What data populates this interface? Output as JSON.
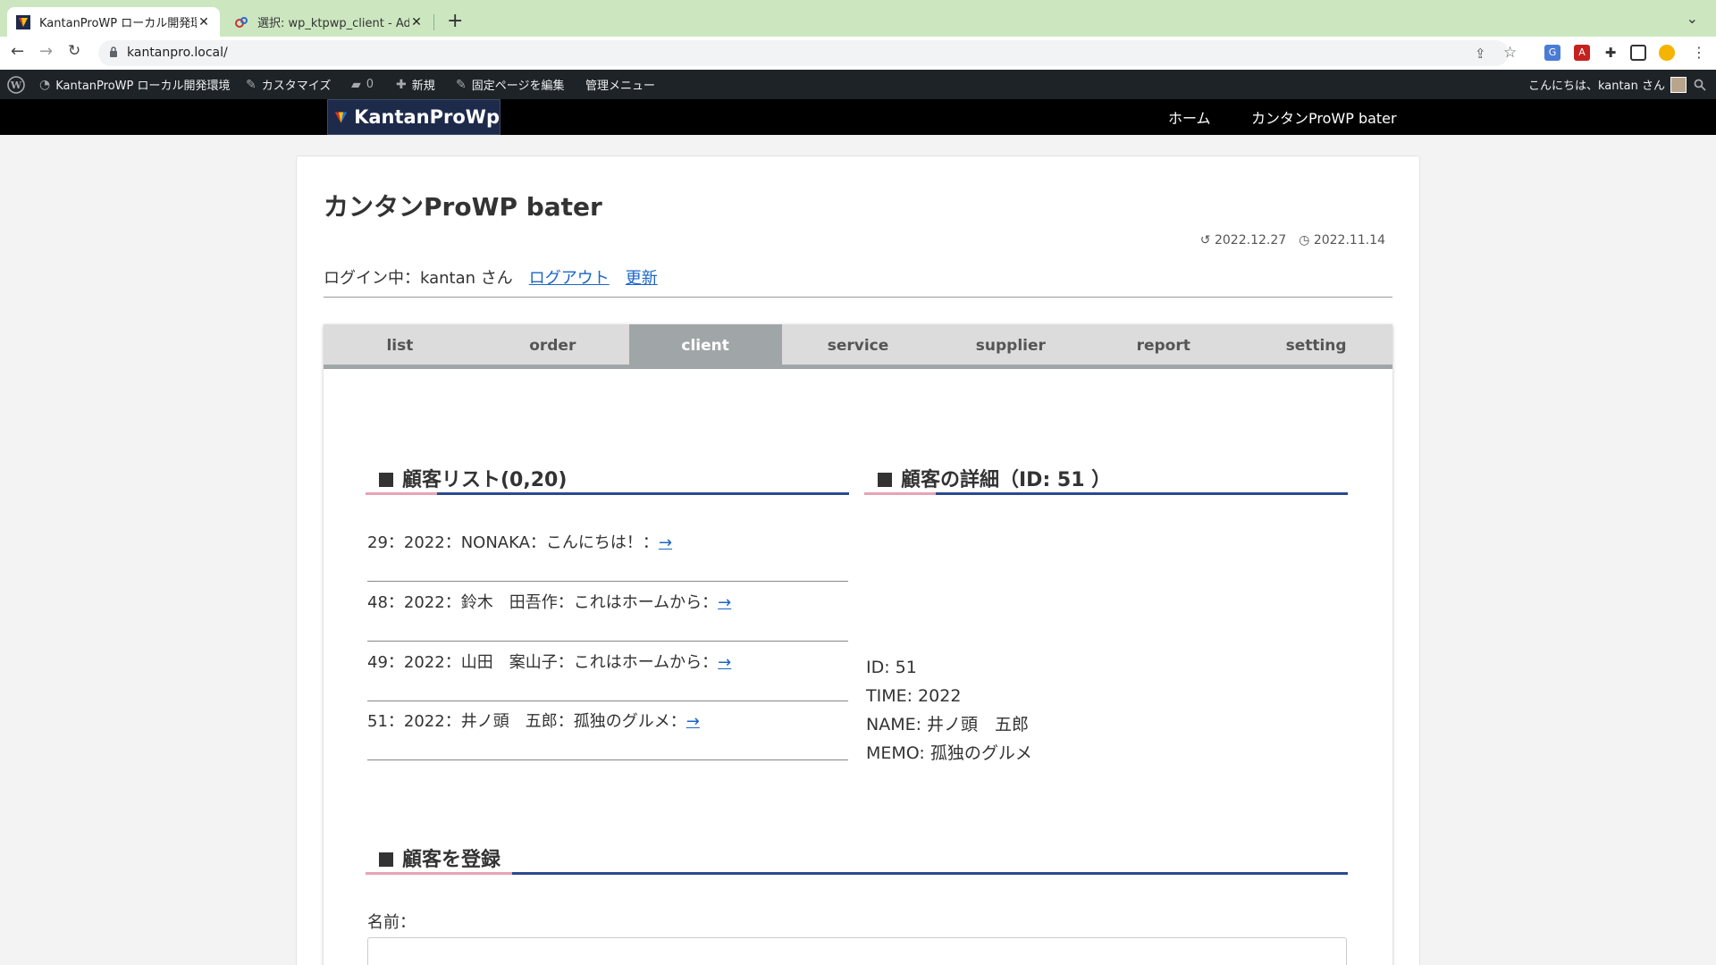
{
  "browser": {
    "tabs": [
      {
        "title": "KantanProWP ローカル開発環境",
        "active": true
      },
      {
        "title": "選択: wp_ktpwp_client - Adminer",
        "active": false
      }
    ],
    "url": "kantanpro.local/"
  },
  "adminbar": {
    "site_name": "KantanProWP ローカル開発環境",
    "customize": "カスタマイズ",
    "comments_count": "0",
    "new": "新規",
    "edit_page": "固定ページを編集",
    "admin_menu": "管理メニュー",
    "greeting": "こんにちは、kantan さん"
  },
  "header": {
    "logo_text": "KantanProWp",
    "nav": [
      "ホーム",
      "カンタンProWP bater"
    ]
  },
  "page": {
    "title": "カンタンProWP bater",
    "modified_date": "2022.12.27",
    "published_date": "2022.11.14",
    "login_text": "ログイン中：kantan さん",
    "logout_link": "ログアウト",
    "refresh_link": "更新"
  },
  "plugin_tabs": [
    "list",
    "order",
    "client",
    "service",
    "supplier",
    "report",
    "setting"
  ],
  "active_tab": "client",
  "client_list": {
    "heading": "顧客リスト(0,20)",
    "rows": [
      {
        "text": "29：2022：NONAKA：こんにちは！：",
        "link": "→"
      },
      {
        "text": "48：2022：鈴木　田吾作：これはホームから：",
        "link": "→"
      },
      {
        "text": "49：2022：山田　案山子：これはホームから：",
        "link": "→"
      },
      {
        "text": "51：2022：井ノ頭　五郎：孤独のグルメ：",
        "link": "→"
      }
    ]
  },
  "client_detail": {
    "heading": "顧客の詳細（ID: 51 ）",
    "lines": [
      "ID: 51",
      "TIME: 2022",
      "NAME: 井ノ頭　五郎",
      "MEMO: 孤独のグルメ"
    ]
  },
  "register": {
    "heading": "顧客を登録",
    "name_label": "名前："
  }
}
